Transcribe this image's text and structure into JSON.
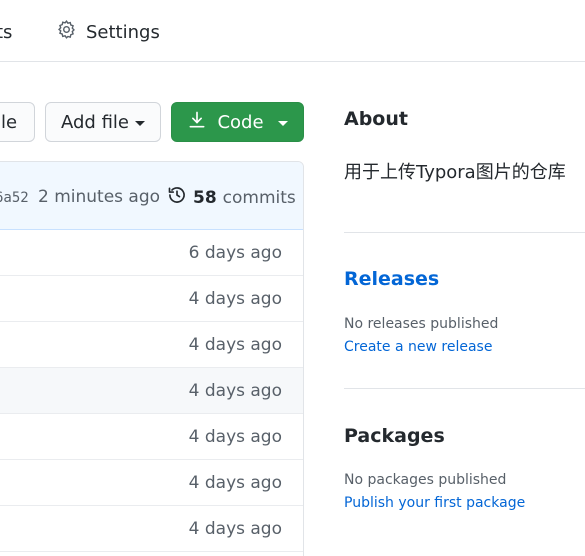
{
  "nav": {
    "partial_tab": "ts",
    "settings_label": "Settings"
  },
  "toolbar": {
    "partial_button": "le",
    "add_file_label": "Add file",
    "code_label": "Code"
  },
  "commit_bar": {
    "hash": "6a52",
    "time": "2 minutes ago",
    "commit_count": "58",
    "commit_word": "commits"
  },
  "files": [
    {
      "age": "6 days ago"
    },
    {
      "age": "4 days ago"
    },
    {
      "age": "4 days ago"
    },
    {
      "age": "4 days ago"
    },
    {
      "age": "4 days ago"
    },
    {
      "age": "4 days ago"
    },
    {
      "age": "4 days ago"
    }
  ],
  "sidebar": {
    "about_title": "About",
    "about_description": "用于上传Typora图片的仓库",
    "releases_title": "Releases",
    "no_releases": "No releases published",
    "create_release": "Create a new release",
    "packages_title": "Packages",
    "no_packages": "No packages published",
    "publish_package": "Publish your first package"
  },
  "colors": {
    "primary_green": "#2c974b",
    "link_blue": "#0366d6",
    "muted_text": "#586069",
    "commit_bar_bg": "#f1f8ff"
  },
  "icons": {
    "settings": "gear-icon",
    "code_download": "download-icon",
    "history": "history-icon"
  }
}
